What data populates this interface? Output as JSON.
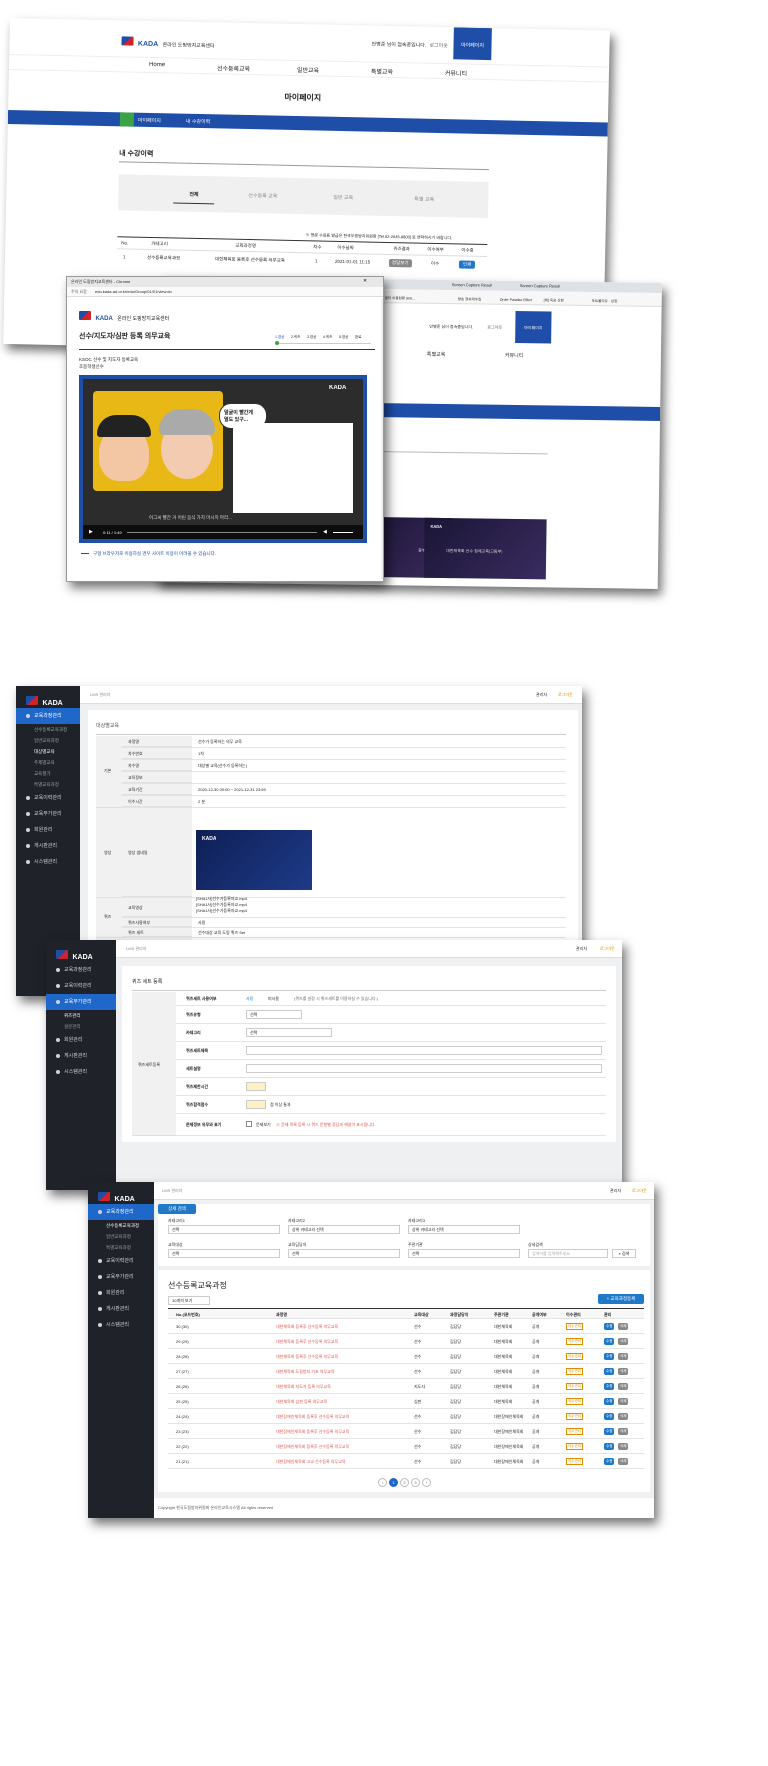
{
  "brand": {
    "kada": "KADA",
    "center": "온라인 도핑방지교육센터",
    "kada_logo": "KADA"
  },
  "ss1": {
    "greeting": "안병준 님이 접속중입니다.",
    "logout": "로그아웃",
    "mypage": "마이페이지",
    "nav": [
      "Home",
      "선수등록교육",
      "일반교육",
      "특별교육",
      "커뮤니티"
    ],
    "title": "마이페이지",
    "crumb": [
      "마이페이지",
      "내 수강이력"
    ],
    "section_title": "내 수강이력",
    "tabs": [
      "전체",
      "선수등록 교육",
      "일반 교육",
      "특별 교육"
    ],
    "notice": "※ 영문 수료증 발급은 한국도핑방지위원회 [Tel.02-2045-9800] 로 연락하시기 바랍니다.",
    "table_headers": [
      "No.",
      "카테고리",
      "교육과정명",
      "차수",
      "이수날짜",
      "퀴즈결과",
      "이수여부",
      "이수증"
    ],
    "table_row": [
      "1",
      "선수등록교육과정",
      "대한체육회 등록후 선수등록 의무교육",
      "1",
      "2021-01-01 11:15",
      "정답보기",
      "이수",
      "인쇄"
    ]
  },
  "popup": {
    "window_title": "온라인 도핑방지교육센터 - Chrome",
    "secure": "주의 요함",
    "url": "edu.kada-ad.or.kr/edu/Group/01/01/view.do",
    "course_title": "선수/지도자/심판 등록 의무교육",
    "steps": [
      "1.영상",
      "2.퀴즈",
      "3.영상",
      "4.퀴즈",
      "5.영상",
      "완료"
    ],
    "subtitle1": "KSOC 선수 및 지도자 등록교육",
    "subtitle2": "초등학생선수",
    "speech1": "얼굴이 빨간게",
    "speech2": "열도 있구...",
    "caption": "어그씨 빨간 거 어린 음식 가지 마시지 마라...",
    "player_time": "0:11 / 1:49",
    "note": "구형 브라우저로 이용하실 경우 사이트 이용이 어려울 수 있습니다."
  },
  "ss1b": {
    "tabs": [
      "Screen Capture Result",
      "Screen Capture Result"
    ],
    "bookmarks": [
      "필터 이용현황 (KB...",
      "방송 정보재수집",
      "Order Parallax Effect",
      "[제] 독표 신청",
      "포트폴리오 · 상장"
    ],
    "greeting": "안병준 님이 접속중입니다.",
    "logout": "로그아웃",
    "mypage": "마이페이지",
    "nav": [
      "특별교육",
      "커뮤니티"
    ],
    "card_text": "대한체육회 선수 집체교육(고등부)",
    "card_text_left": "중부)"
  },
  "admin_common": {
    "breadcrumb": "LMS 관리자",
    "admin_user": "관리자",
    "logout": "로그아웃",
    "menu": [
      "교육과정관리",
      "교육이력관리",
      "교육부가관리",
      "회원관리",
      "게시판관리",
      "시스템관리"
    ]
  },
  "ss2": {
    "submenu": [
      "선수등록교육과정",
      "일반교육과정",
      "대상별교육",
      "주제별교육",
      "교육평가",
      "특별교육과정"
    ],
    "section": "대상별교육",
    "groups": [
      "기본",
      "영상",
      "퀴즈",
      "설문"
    ],
    "labels": [
      "과정명",
      "차수번호",
      "차수명",
      "교육정보",
      "교육기간",
      "이수시간",
      "영상 썸네일",
      "교육영상",
      "퀴즈사용여부",
      "퀴즈 세트",
      "퀴즈 노출 위치",
      "설문사용여부",
      "설문 세트"
    ],
    "values": [
      "선수가 등록하는 의무 교육",
      "1차",
      "대상별 교육(선수가 등록하는)",
      "",
      "2020-12-30 00:00 ~ 2021-12-31 23:59",
      "2 분",
      "",
      "",
      "사용",
      "선수대상 교육 도핑 퀴즈 Set",
      "이전영상 완료 후",
      "사용",
      "만족도 조사 설문 Set"
    ],
    "files": [
      "[SHA1사]선수가등록자교.mp4",
      "[SHA1사]선수가등록자교.mp4",
      "[SHA1사]선수가등록자교.mp4"
    ]
  },
  "ss3": {
    "submenu": [
      "퀴즈관리",
      "설문관리"
    ],
    "title": "퀴즈 세트 등록",
    "group": "퀴즈세트등록",
    "labels": [
      "퀴즈세트 사용여부",
      "퀴즈유형",
      "카테고리",
      "퀴즈세트제목",
      "세트설명",
      "퀴즈제한시간",
      "퀴즈합격점수",
      "문제정보 유무와 표기"
    ],
    "use_yes": "사용",
    "use_no": "미사용",
    "use_note": "(퀴즈를 설정 시 퀴즈세트를 이용하실 수 있습니다.)",
    "select_default": "선택",
    "pass_suffix": "점 이상 통과",
    "display_label": "문제보기",
    "display_note": "※ 문제 목록 등록 시 퀴즈 문항별 정답과 해설이 표시됩니다."
  },
  "ss4": {
    "submenu": [
      "선수등록교육과정",
      "일반교육과정",
      "특별교육과정"
    ],
    "search_tab": "상세 검색",
    "filters": [
      "카테고리1",
      "카테고리2",
      "카테고리3",
      "교육대상",
      "교육담당자",
      "주관기관",
      "상세검색"
    ],
    "filter_values": [
      "선택",
      "상위 카테고리 선택",
      "상위 카테고리 선택",
      "선택",
      "선택",
      "선택"
    ],
    "search_placeholder": "검색어를 입력해주세요.",
    "search_btn": "검색",
    "list_title": "선수등록교육과정",
    "page_size": "10개씩 보기",
    "add_btn": "+ 교육과정등록",
    "headers": [
      "No.(코드번호)",
      "과정명",
      "교육대상",
      "과정담당자",
      "주관기관",
      "공개여부",
      "이수관리",
      "관리"
    ],
    "rows": [
      [
        "30 (30)",
        "대한체육회 등록후 선수등록 의무교육",
        "선수",
        "김담당",
        "대한체육회",
        "공개"
      ],
      [
        "29 (29)",
        "대한체육회 등록후 선수등록 의무교육",
        "선수",
        "김담당",
        "대한체육회",
        "공개"
      ],
      [
        "28 (28)",
        "대한체육회 등록후 선수등록 의무교육",
        "선수",
        "김담당",
        "대한체육회",
        "공개"
      ],
      [
        "27 (27)",
        "대한체육회 도핑방지 기초 의무교육",
        "선수",
        "김담당",
        "대한체육회",
        "공개"
      ],
      [
        "26 (26)",
        "대한체육회 지도자 등록 의무교육",
        "지도자",
        "김담당",
        "대한체육회",
        "공개"
      ],
      [
        "25 (25)",
        "대한체육회 심판 등록 의무교육",
        "심판",
        "김담당",
        "대한체육회",
        "공개"
      ],
      [
        "24 (24)",
        "대한장애인체육회 등록후 선수등록 의무교육",
        "선수",
        "김담당",
        "대한장애인체육회",
        "공개"
      ],
      [
        "23 (23)",
        "대한장애인체육회 등록후 선수등록 의무교육",
        "선수",
        "김담당",
        "대한장애인체육회",
        "공개"
      ],
      [
        "22 (22)",
        "대한장애인체육회 등록후 선수등록 의무교육",
        "선수",
        "김담당",
        "대한장애인체육회",
        "공개"
      ],
      [
        "21 (21)",
        "대한장애인체육회 고교 선수등록 의무교육",
        "선수",
        "김담당",
        "대한장애인체육회",
        "공개"
      ]
    ],
    "manage_label": "이수관리",
    "edit_label": "수정",
    "delete_label": "삭제",
    "pages": [
      "‹",
      "1",
      "2",
      "3",
      "›"
    ],
    "footer": "Copyright 한국도핑방지위원회 온라인교육시스템 All rights reserved"
  }
}
